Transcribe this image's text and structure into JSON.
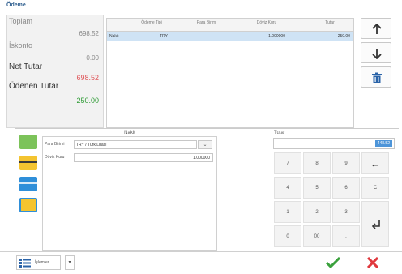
{
  "window": {
    "title": "Ödeme"
  },
  "summary": {
    "toplam_label": "Toplam",
    "toplam_value": "698.52",
    "iskonto_label": "İskonto",
    "iskonto_value": "0.00",
    "net_label": "Net Tutar",
    "net_value": "698.52",
    "odenen_label": "Ödenen Tutar",
    "odenen_value": "250.00"
  },
  "grid": {
    "headers": [
      "Ödeme Tipi",
      "Para Birimi",
      "Döviz Kuru",
      "Tutar"
    ],
    "rows": [
      {
        "tip": "Nakit",
        "para": "TRY",
        "kur": "1.000000",
        "tutar": "250.00"
      }
    ]
  },
  "payment": {
    "header": "Nakit",
    "para_birimi_label": "Para Birimi",
    "para_birimi_value": "TRY / Türk Lirası",
    "doviz_kuru_label": "Döviz Kuru",
    "doviz_kuru_value": "1.000000"
  },
  "amount": {
    "label": "Tutar",
    "value": "448.52"
  },
  "keypad": {
    "keys": [
      "7",
      "8",
      "9",
      "←",
      "4",
      "5",
      "6",
      "C",
      "1",
      "2",
      "3",
      "0",
      "00",
      "."
    ]
  },
  "bottom": {
    "islemler_label": "İşlemler",
    "dropdown_glyph": "▾"
  },
  "icons": [
    "arrow-up-icon",
    "arrow-down-icon",
    "trash-icon",
    "cash-icon",
    "card-icon",
    "bank-card-icon",
    "voucher-icon",
    "list-icon",
    "check-icon",
    "cross-icon",
    "enter-icon"
  ],
  "colors": {
    "accent": "#4e95d9",
    "positive": "#2e9b35",
    "negative": "#e0575b",
    "selection": "#cfe3f5"
  }
}
